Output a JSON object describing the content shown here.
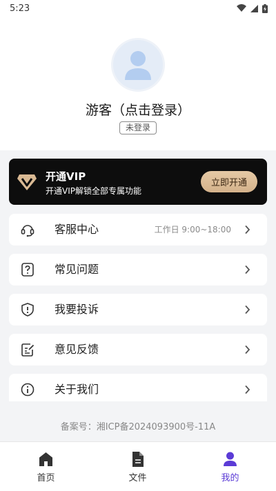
{
  "status_bar": {
    "time": "5:23"
  },
  "profile": {
    "name": "游客（点击登录）",
    "login_status": "未登录"
  },
  "vip": {
    "title": "开通VIP",
    "subtitle": "开通VIP解锁全部专属功能",
    "button_label": "立即开通"
  },
  "menu": {
    "items": [
      {
        "label": "客服中心",
        "extra": "工作日 9:00~18:00",
        "icon": "headset-icon"
      },
      {
        "label": "常见问题",
        "extra": "",
        "icon": "question-icon"
      },
      {
        "label": "我要投诉",
        "extra": "",
        "icon": "complaint-icon"
      },
      {
        "label": "意见反馈",
        "extra": "",
        "icon": "feedback-icon"
      },
      {
        "label": "关于我们",
        "extra": "",
        "icon": "info-icon"
      }
    ]
  },
  "footer": {
    "record": "备案号：湘ICP备2024093900号-11A"
  },
  "tab_bar": {
    "tabs": [
      {
        "label": "首页",
        "icon": "home-icon"
      },
      {
        "label": "文件",
        "icon": "file-icon"
      },
      {
        "label": "我的",
        "icon": "user-icon",
        "active": true
      }
    ]
  },
  "colors": {
    "accent": "#5b3bd6",
    "vip_gold": "#d9b993",
    "vip_bg": "#0d0d0d"
  }
}
